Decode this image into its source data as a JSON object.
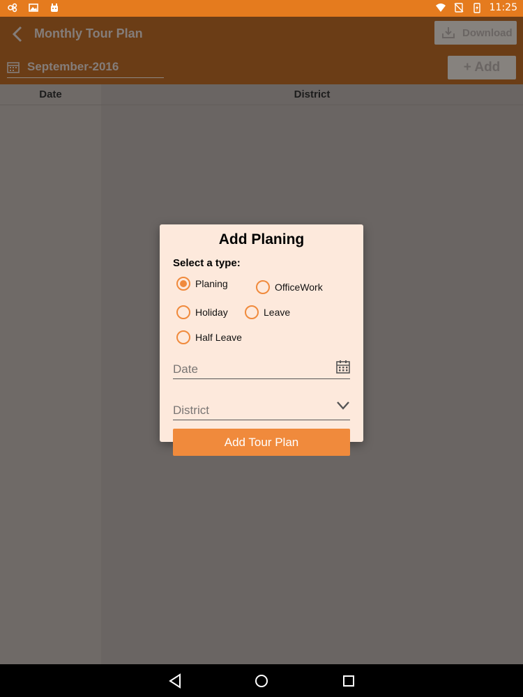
{
  "status_bar": {
    "time": "11:25",
    "icons": [
      "app-icon",
      "gallery-icon",
      "android-icon",
      "wifi-icon",
      "no-sim-icon",
      "battery-charging-icon"
    ]
  },
  "toolbar": {
    "title": "Monthly Tour Plan",
    "download_label": "Download",
    "month_value": "September-2016",
    "add_label": "+ Add"
  },
  "table": {
    "columns": [
      "Date",
      "District"
    ]
  },
  "dialog": {
    "title": "Add Planing",
    "type_label": "Select a type:",
    "options": [
      {
        "label": "Planing",
        "checked": true
      },
      {
        "label": "OfficeWork",
        "checked": false
      },
      {
        "label": "Holiday",
        "checked": false
      },
      {
        "label": "Leave",
        "checked": false
      },
      {
        "label": "Half Leave",
        "checked": false
      }
    ],
    "date_placeholder": "Date",
    "district_placeholder": "District",
    "submit_label": "Add Tour Plan"
  },
  "colors": {
    "accent": "#f08a3c",
    "status_bar": "#e57b1e",
    "dialog_bg": "#fde9dc"
  }
}
